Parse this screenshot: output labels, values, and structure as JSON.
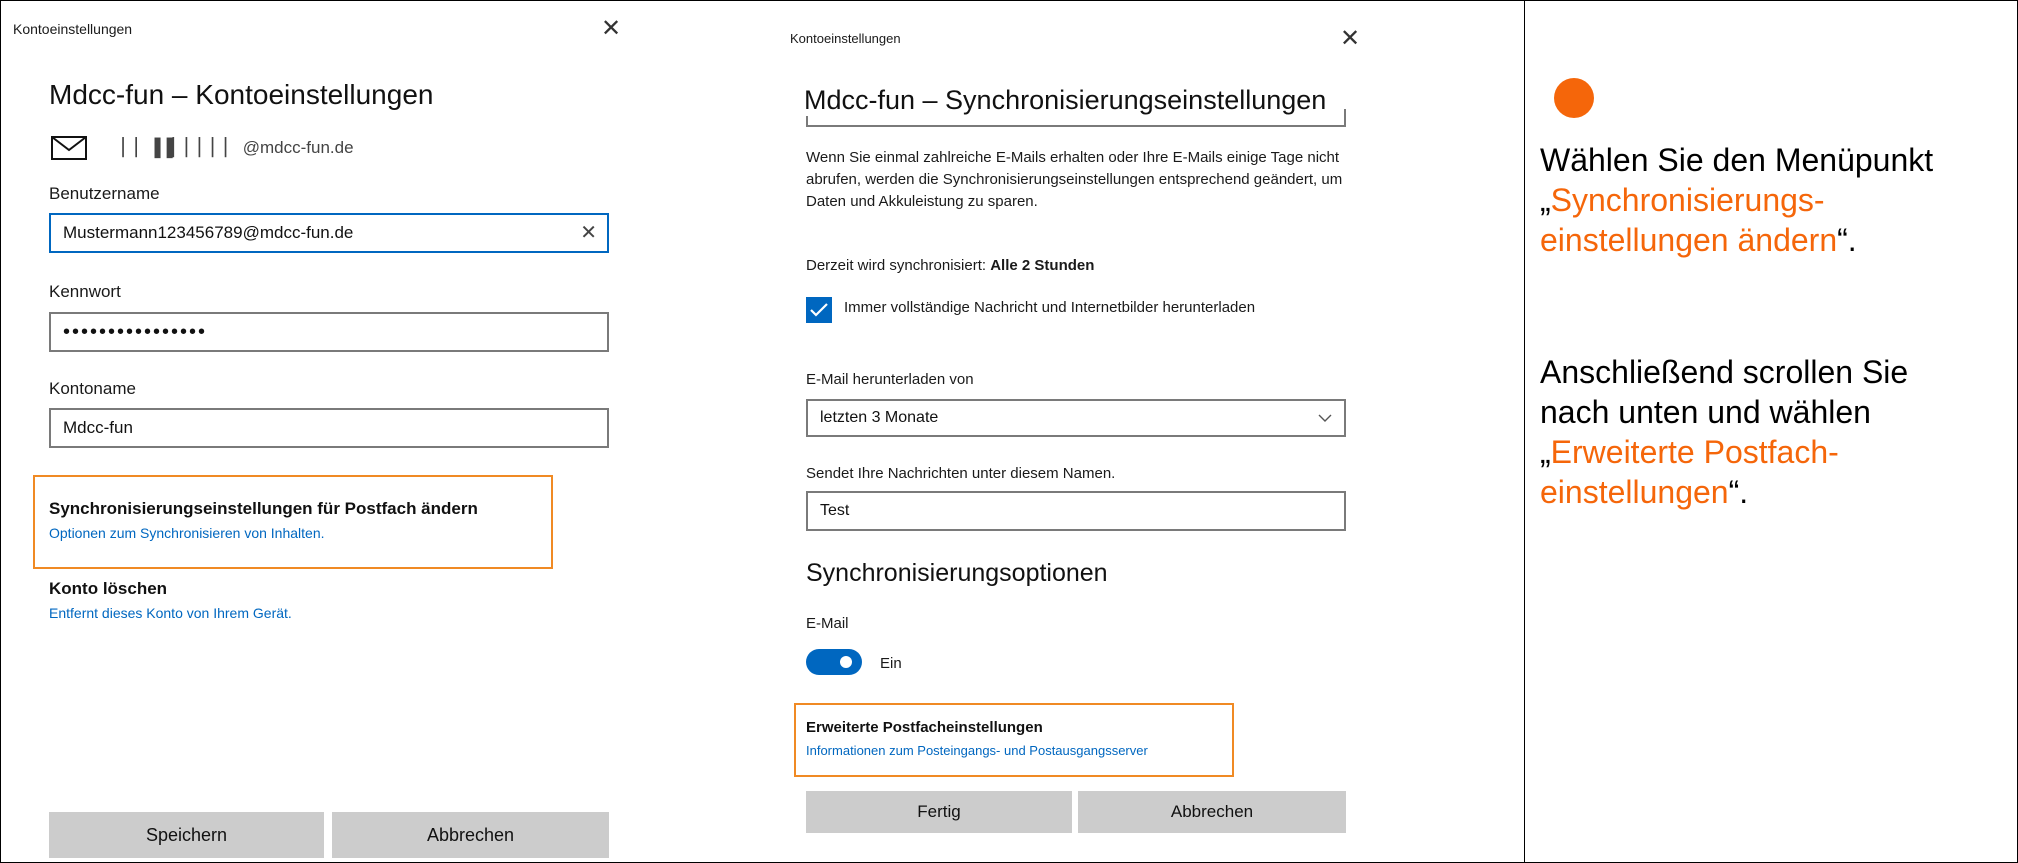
{
  "left_dialog": {
    "window_title": "Kontoeinstellungen",
    "heading": "Mdcc-fun – Kontoeinstellungen",
    "email_display": " ▏▏▐▐▏▏▏▏▏ @mdcc-fun.de",
    "username_label": "Benutzername",
    "username_value": "Mustermann123456789@mdcc-fun.de",
    "password_label": "Kennwort",
    "password_value": "••••••••••••••••",
    "accountname_label": "Kontoname",
    "accountname_value": "Mdcc-fun",
    "sync_settings_title": "Synchronisierungseinstellungen für Postfach ändern",
    "sync_settings_sub": "Optionen zum Synchronisieren von Inhalten.",
    "delete_title": "Konto löschen",
    "delete_sub": "Entfernt dieses Konto von Ihrem Gerät.",
    "save_label": "Speichern",
    "cancel_label": "Abbrechen"
  },
  "middle_dialog": {
    "window_title": "Kontoeinstellungen",
    "heading": "Mdcc-fun – Synchronisierungseinstellungen",
    "info_text": "Wenn Sie einmal zahlreiche E-Mails erhalten oder Ihre E-Mails einige Tage nicht abrufen, werden die Synchronisierungseinstellungen entsprechend geändert, um Daten und Akkuleistung zu sparen.",
    "current_sync_prefix": "Derzeit wird synchronisiert: ",
    "current_sync_value": "Alle 2 Stunden",
    "full_message_checkbox_label": "Immer vollständige Nachricht und Internetbilder herunterladen",
    "full_message_checked": true,
    "download_from_label": "E-Mail herunterladen von",
    "download_from_value": "letzten 3 Monate",
    "send_name_label": "Sendet Ihre Nachrichten unter diesem Namen.",
    "send_name_value": "Test",
    "sync_options_heading": "Synchronisierungsoptionen",
    "email_label": "E-Mail",
    "email_toggle_label": "Ein",
    "email_toggle_on": true,
    "advanced_title": "Erweiterte Postfacheinstellungen",
    "advanced_sub": "Informationen zum Posteingangs- und Postausgangsserver",
    "done_label": "Fertig",
    "cancel_label": "Abbrechen"
  },
  "instructions": {
    "p1_a": "Wählen Sie den Menüpunkt „",
    "p1_highlight": "Synchronisierungs-einstellungen ändern",
    "p1_b": "“.",
    "p2_a": "Anschließend scrollen Sie nach unten und wählen „",
    "p2_highlight": "Erweiterte Postfach-einstellungen",
    "p2_b": "“."
  },
  "colors": {
    "accent_blue": "#0067c0",
    "highlight_orange": "#f08a24",
    "instruction_orange": "#f5660a"
  }
}
